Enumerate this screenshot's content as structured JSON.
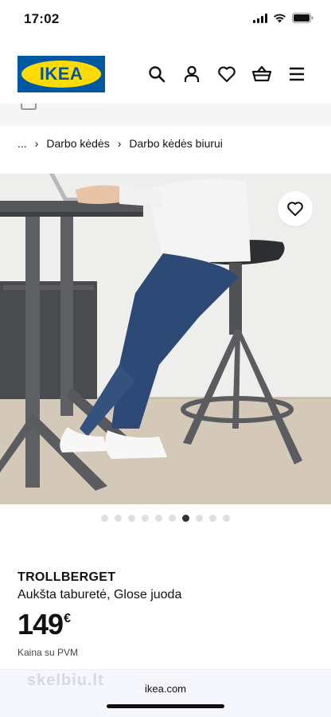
{
  "status_bar": {
    "time": "17:02"
  },
  "header": {
    "logo_text": "IKEA",
    "icons": [
      "search-icon",
      "profile-icon",
      "heart-icon",
      "basket-icon",
      "menu-icon"
    ]
  },
  "breadcrumb": {
    "ellipsis": "...",
    "items": [
      "Darbo kėdės",
      "Darbo kėdės biurui"
    ]
  },
  "carousel": {
    "total": 10,
    "active_index": 6
  },
  "product": {
    "name": "TROLLBERGET",
    "description": "Aukšta taburetė, Glose juoda",
    "price_integer": "149",
    "currency": "€",
    "price_note": "Kaina su PVM"
  },
  "browser": {
    "url": "ikea.com",
    "watermark": "skelbiu.lt"
  },
  "colors": {
    "brand_blue": "#0058a3",
    "brand_yellow": "#ffdb00"
  }
}
